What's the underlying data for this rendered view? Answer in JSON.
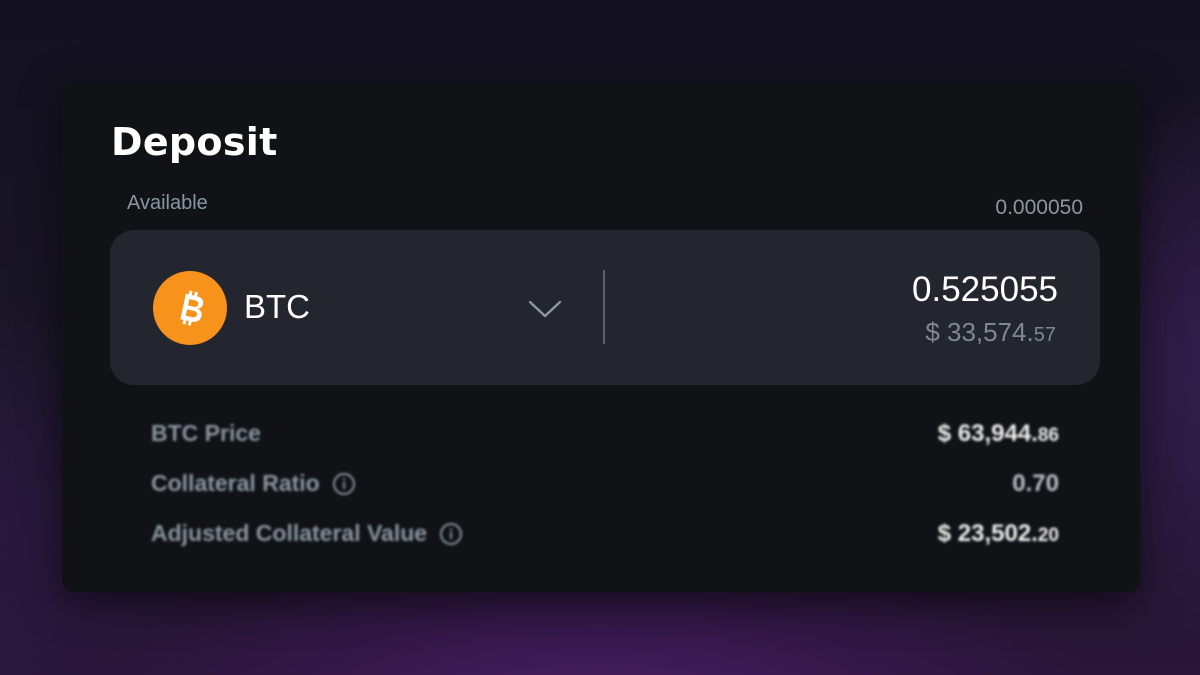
{
  "deposit": {
    "title": "Deposit",
    "available_label": "Available",
    "available_value": "0.000050"
  },
  "asset": {
    "icon": "bitcoin-icon",
    "icon_color": "#f7931a",
    "symbol": "BTC",
    "amount": "0.525055",
    "usd_main": "$ 33,574.",
    "usd_cents": "57"
  },
  "details": {
    "btc_price": {
      "label": "BTC Price",
      "value_main": "$ 63,944.",
      "value_cents": "86"
    },
    "collateral_ratio": {
      "label": "Collateral Ratio",
      "value": "0.70"
    },
    "adjusted_value": {
      "label": "Adjusted Collateral Value",
      "value_main": "$ 23,502.",
      "value_cents": "20"
    }
  }
}
